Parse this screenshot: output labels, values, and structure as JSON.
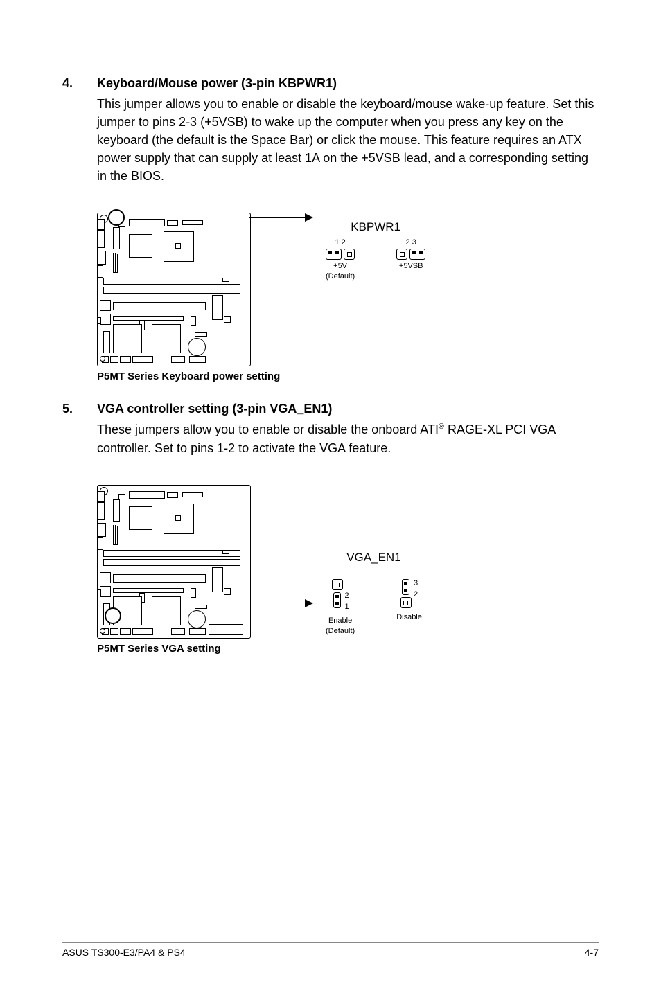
{
  "items": [
    {
      "num": "4.",
      "heading": "Keyboard/Mouse power (3-pin KBPWR1)",
      "body_plain": "This jumper allows you to enable or disable the keyboard/mouse wake-up feature. Set this jumper to pins 2-3 (+5VSB) to wake up the computer when you press any key on the keyboard (the default is the Space Bar) or click the mouse. This feature requires an ATX power supply that can supply at least 1A on the +5VSB lead, and a corresponding setting in the BIOS.",
      "diagram": {
        "caption": "P5MT Series Keyboard power setting",
        "title": "KBPWR1",
        "variants": [
          {
            "pins": "1  2",
            "label": "+5V",
            "sub": "(Default)",
            "cap_side": "left"
          },
          {
            "pins": "2  3",
            "label": "+5VSB",
            "sub": "",
            "cap_side": "right"
          }
        ]
      }
    },
    {
      "num": "5.",
      "heading": "VGA controller setting (3-pin VGA_EN1)",
      "body_pre": "These jumpers allow you to enable or disable the onboard ATI",
      "body_sup": "®",
      "body_post": " RAGE-XL PCI VGA controller. Set to pins 1-2 to activate the VGA feature.",
      "diagram": {
        "caption": "P5MT Series VGA setting",
        "title": "VGA_EN1",
        "variants": [
          {
            "side_a": "2",
            "side_b": "1",
            "label": "Enable",
            "sub": "(Default)",
            "cap_side": "bottom"
          },
          {
            "side_a": "3",
            "side_b": "2",
            "label": "Disable",
            "sub": "",
            "cap_side": "top"
          }
        ]
      }
    }
  ],
  "footer": {
    "left": "ASUS TS300-E3/PA4 & PS4",
    "right": "4-7"
  }
}
